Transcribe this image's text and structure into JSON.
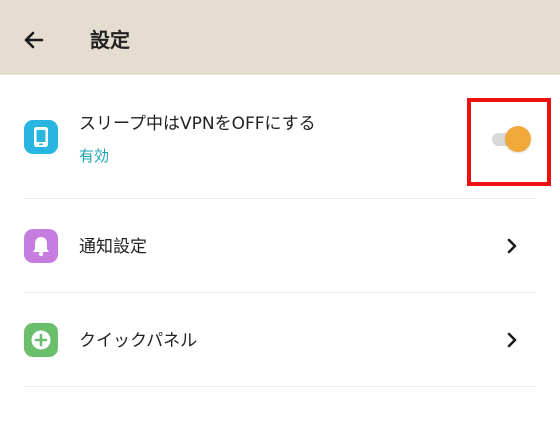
{
  "header": {
    "title": "設定",
    "back_icon": "arrow-left-icon",
    "background": "#e4ddd0"
  },
  "settings": [
    {
      "title": "スリープ中はVPNをOFFにする",
      "subtitle": "有効",
      "subtitle_color": "#1aa3b8",
      "icon": "phone-icon",
      "icon_color": "#28b5e0",
      "control": "toggle",
      "toggle_on": true,
      "toggle_color": "#f0a93a"
    },
    {
      "title": "通知設定",
      "icon": "bell-icon",
      "icon_color": "#c77de0",
      "control": "chevron-right-icon"
    },
    {
      "title": "クイックパネル",
      "icon": "plus-circle-icon",
      "icon_color": "#6cbf6a",
      "control": "chevron-right-icon"
    }
  ],
  "highlight_color": "#ee1111"
}
